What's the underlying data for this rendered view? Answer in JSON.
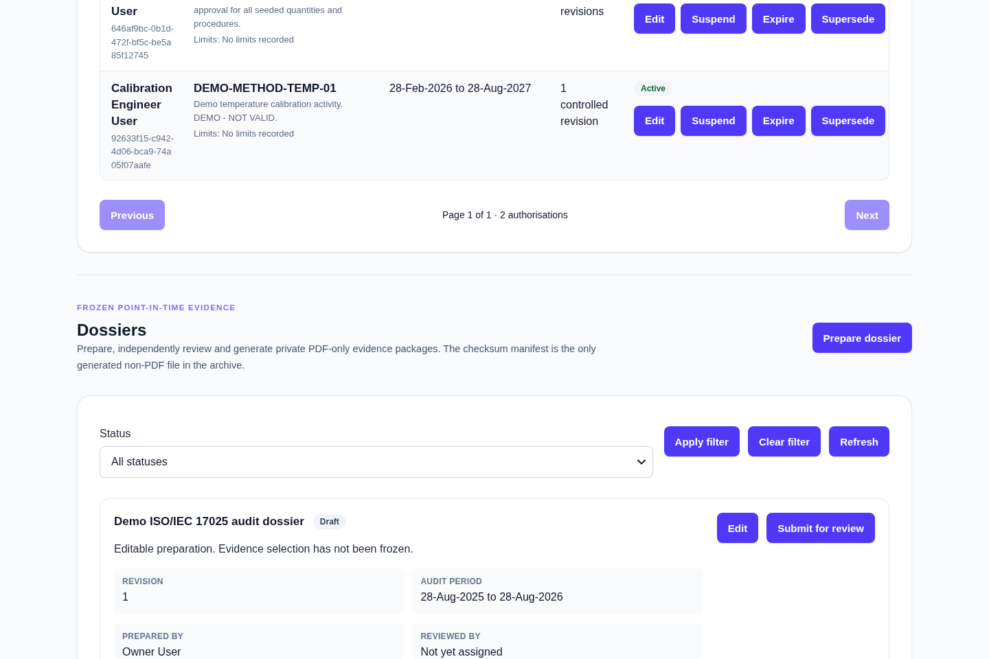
{
  "authorisations": {
    "rows": [
      {
        "user_name": "User",
        "user_id": "646af9bc-0b1d-472f-bf5c-be5a85f12745",
        "description": "approval for all seeded quantities and procedures.",
        "limits": "Limits: No limits recorded",
        "revisions": "revisions",
        "actions": [
          "Edit",
          "Suspend",
          "Expire",
          "Supersede"
        ]
      },
      {
        "user_name": "Calibration Engineer User",
        "user_id": "92633f15-c942-4d06-bca9-74a05f07aafe",
        "method_code": "DEMO-METHOD-TEMP-01",
        "description": "Demo temperature calibration activity. DEMO - NOT VALID.",
        "limits": "Limits: No limits recorded",
        "validity": "28-Feb-2026 to 28-Aug-2027",
        "revisions": "1 controlled revision",
        "status": {
          "label": "Active",
          "kind": "active"
        },
        "actions": [
          "Edit",
          "Suspend",
          "Expire",
          "Supersede"
        ]
      }
    ],
    "pagination": {
      "previous": {
        "label": "Previous",
        "disabled": true
      },
      "summary": "Page 1 of 1 · 2 authorisations",
      "next": {
        "label": "Next",
        "disabled": true
      }
    }
  },
  "dossiers": {
    "eyebrow": "FROZEN POINT-IN-TIME EVIDENCE",
    "title": "Dossiers",
    "description": "Prepare, independently review and generate private PDF-only evidence packages. The checksum manifest is the only generated non-PDF file in the archive.",
    "action": "Prepare dossier",
    "filter": {
      "label": "Status",
      "value": "All statuses",
      "buttons": [
        "Apply filter",
        "Clear filter",
        "Refresh"
      ]
    },
    "items": [
      {
        "title": "Demo ISO/IEC 17025 audit dossier",
        "status": {
          "label": "Draft",
          "kind": "draft"
        },
        "note": "Editable preparation. Evidence selection has not been frozen.",
        "actions": [
          "Edit",
          "Submit for review"
        ],
        "fields": [
          {
            "label": "REVISION",
            "value": "1"
          },
          {
            "label": "AUDIT PERIOD",
            "value": "28-Aug-2025 to 28-Aug-2026"
          },
          {
            "label": "PREPARED BY",
            "value": "Owner User"
          },
          {
            "label": "REVIEWED BY",
            "value": "Not yet assigned"
          }
        ]
      }
    ]
  }
}
